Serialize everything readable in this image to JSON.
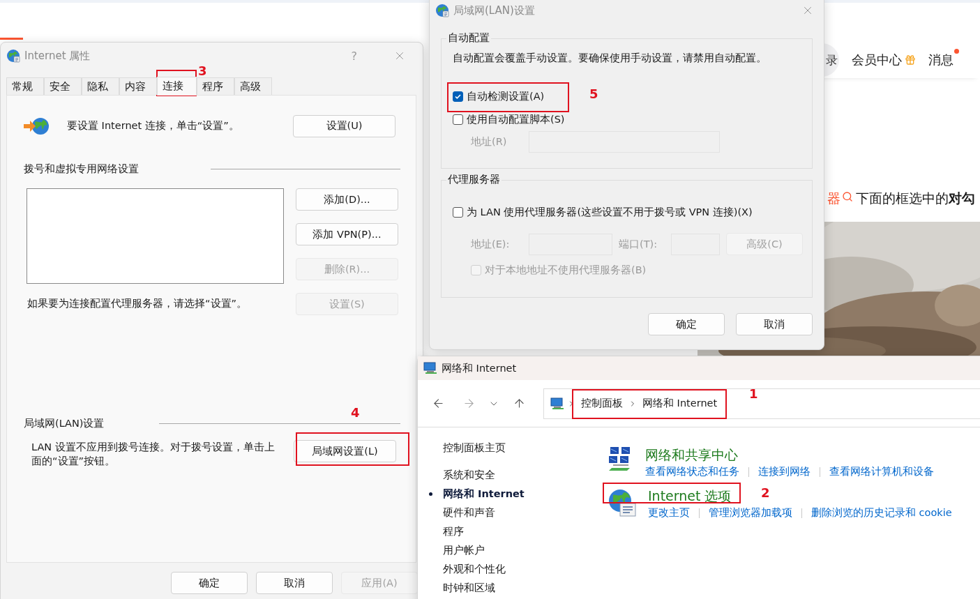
{
  "web_page": {
    "header": {
      "avatar_text": "录",
      "member_center": "会员中心",
      "messages": "消息",
      "has_unread": true
    },
    "article": {
      "highlight": "器",
      "text": "下面的框选中的**对勾**"
    }
  },
  "internet_properties": {
    "title": "Internet 属性",
    "help": "?",
    "tabs": [
      {
        "label": "常规",
        "selected": false
      },
      {
        "label": "安全",
        "selected": false
      },
      {
        "label": "隐私",
        "selected": false
      },
      {
        "label": "内容",
        "selected": false
      },
      {
        "label": "连接",
        "selected": true
      },
      {
        "label": "程序",
        "selected": false
      },
      {
        "label": "高级",
        "selected": false
      }
    ],
    "setup": {
      "text": "要设置 Internet 连接，单击“设置”。",
      "button": "设置(U)"
    },
    "dialup": {
      "heading": "拨号和虚拟专用网络设置",
      "buttons": [
        {
          "label": "添加(D)...",
          "disabled": false
        },
        {
          "label": "添加 VPN(P)...",
          "disabled": false
        },
        {
          "label": "删除(R)...",
          "disabled": true
        },
        {
          "label": "设置(S)",
          "disabled": true
        }
      ],
      "hint": "如果要为连接配置代理服务器，请选择“设置”。"
    },
    "lan": {
      "heading": "局域网(LAN)设置",
      "text": "LAN 设置不应用到拨号连接。对于拨号设置，单击上面的“设置”按钮。",
      "button": "局域网设置(L)"
    },
    "buttons": [
      {
        "label": "确定",
        "disabled": false
      },
      {
        "label": "取消",
        "disabled": false
      },
      {
        "label": "应用(A)",
        "disabled": true
      }
    ]
  },
  "lan_dialog": {
    "title": "局域网(LAN)设置",
    "auto_config": {
      "heading": "自动配置",
      "description": "自动配置会覆盖手动设置。要确保使用手动设置，请禁用自动配置。",
      "options": [
        {
          "label": "自动检测设置(A)",
          "checked": true
        },
        {
          "label": "使用自动配置脚本(S)",
          "checked": false
        }
      ],
      "address": {
        "label": "地址(R)",
        "disabled": true
      }
    },
    "proxy": {
      "heading": "代理服务器",
      "use_proxy": {
        "label": "为 LAN 使用代理服务器(这些设置不用于拨号或 VPN 连接)(X)",
        "checked": false
      },
      "fields_disabled": true,
      "address_label": "地址(E):",
      "port_label": "端口(T):",
      "advanced_button": "高级(C)",
      "bypass": {
        "label": "对于本地地址不使用代理服务器(B)",
        "checked": false
      }
    },
    "buttons": [
      "确定",
      "取消"
    ]
  },
  "control_panel": {
    "title": "网络和 Internet",
    "breadcrumb": [
      "控制面板",
      "网络和 Internet"
    ],
    "nav": [
      {
        "label": "控制面板主页",
        "selected": false
      },
      {
        "label": "系统和安全",
        "selected": false
      },
      {
        "label": "网络和 Internet",
        "selected": true
      },
      {
        "label": "硬件和声音",
        "selected": false
      },
      {
        "label": "程序",
        "selected": false
      },
      {
        "label": "用户帐户",
        "selected": false
      },
      {
        "label": "外观和个性化",
        "selected": false
      },
      {
        "label": "时钟和区域",
        "selected": false
      }
    ],
    "categories": [
      {
        "kind": "network",
        "title": "网络和共享中心",
        "links": [
          "查看网络状态和任务",
          "连接到网络",
          "查看网络计算机和设备"
        ]
      },
      {
        "kind": "internet",
        "title": "Internet 选项",
        "links": [
          "更改主页",
          "管理浏览器加载项",
          "删除浏览的历史记录和 cookie"
        ]
      }
    ]
  },
  "annotations": [
    {
      "label": "1"
    },
    {
      "label": "2"
    },
    {
      "label": "3"
    },
    {
      "label": "4"
    },
    {
      "label": "5"
    }
  ]
}
